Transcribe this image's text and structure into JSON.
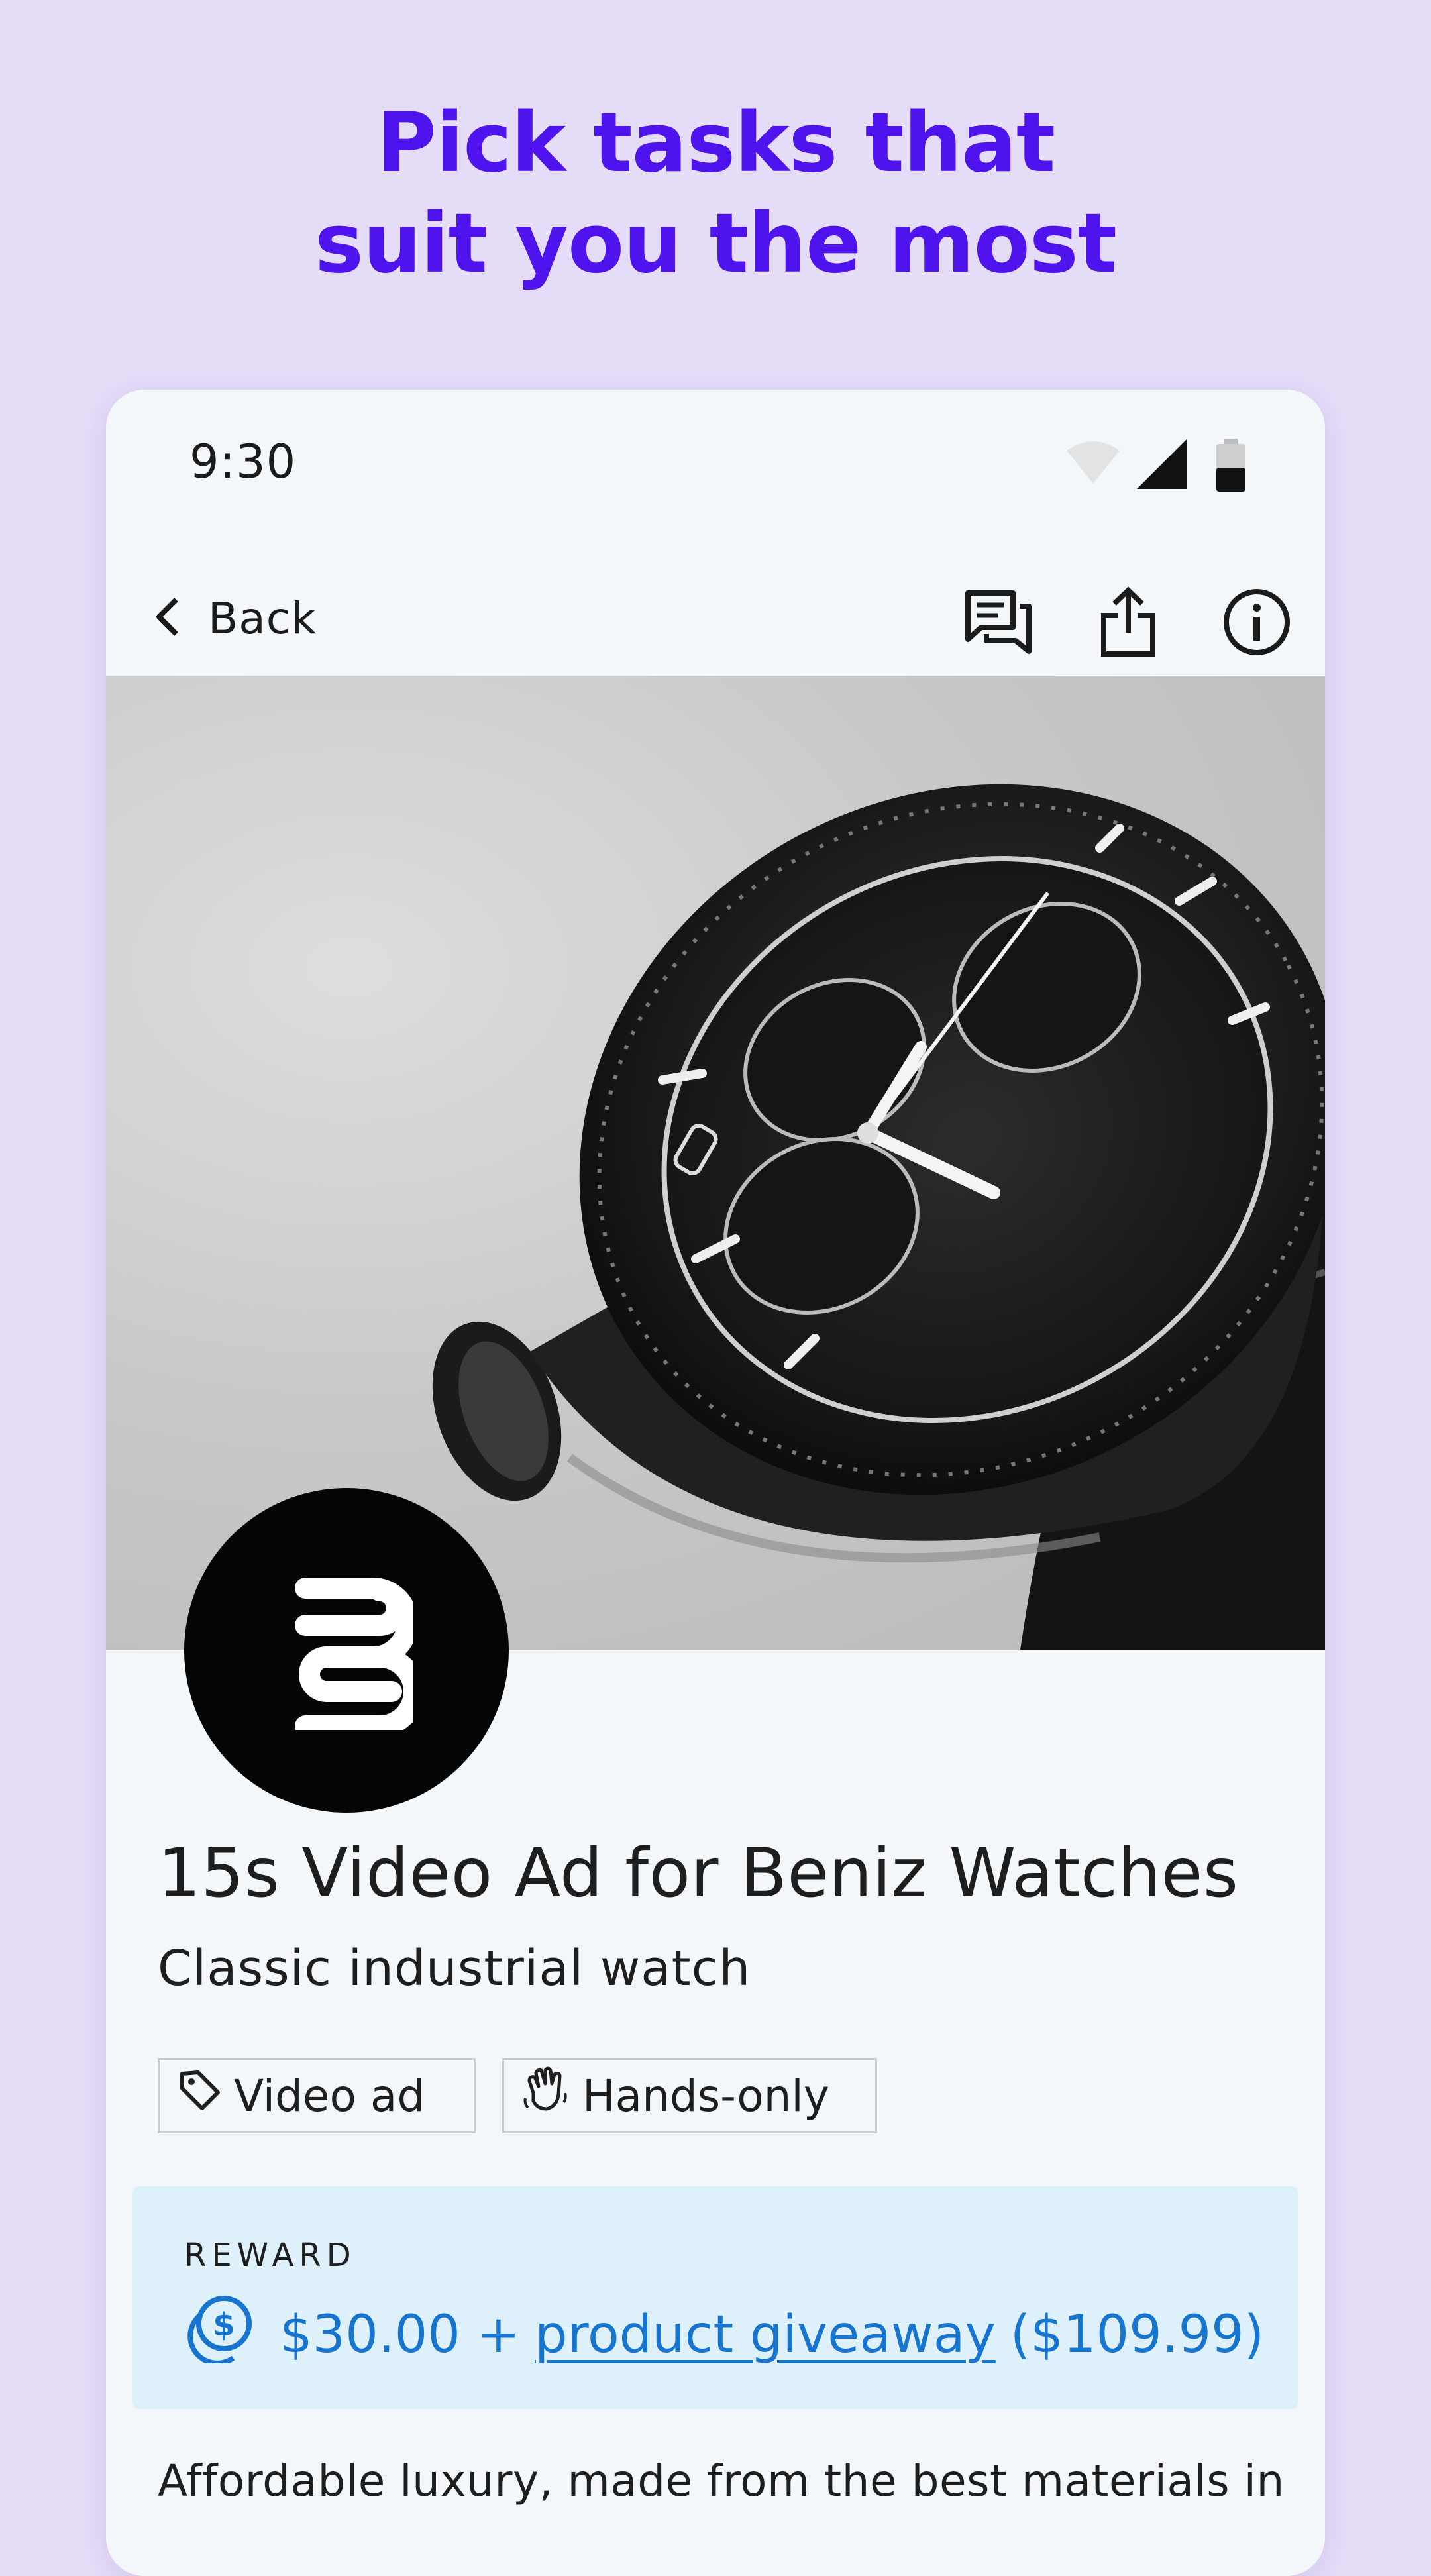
{
  "promo": {
    "line1": "Pick tasks that",
    "line2": "suit you the most"
  },
  "status_bar": {
    "time": "9:30",
    "icons": [
      "wifi-icon",
      "signal-icon",
      "battery-icon"
    ]
  },
  "toolbar": {
    "back_label": "Back",
    "actions": [
      "chat-icon",
      "share-icon",
      "info-icon"
    ]
  },
  "task": {
    "image": "wristwatch-photo",
    "logo": "brand-logo",
    "title": "15s Video Ad for Beniz Watches",
    "subtitle": "Classic industrial watch",
    "tags": [
      {
        "label": "Video ad",
        "icon": "tag-icon"
      },
      {
        "label": "Hands-only",
        "icon": "hand-icon"
      }
    ],
    "reward": {
      "label": "REWARD",
      "amount": "$30.00 +",
      "link_text": "product giveaway",
      "value": "($109.99)",
      "icon": "coins-icon"
    },
    "description": "Affordable luxury, made from the best materials in"
  },
  "colors": {
    "background": "#e5dcf8",
    "headline": "#4f14ee",
    "reward_bg": "#def1fb",
    "reward_text": "#1875cf"
  }
}
